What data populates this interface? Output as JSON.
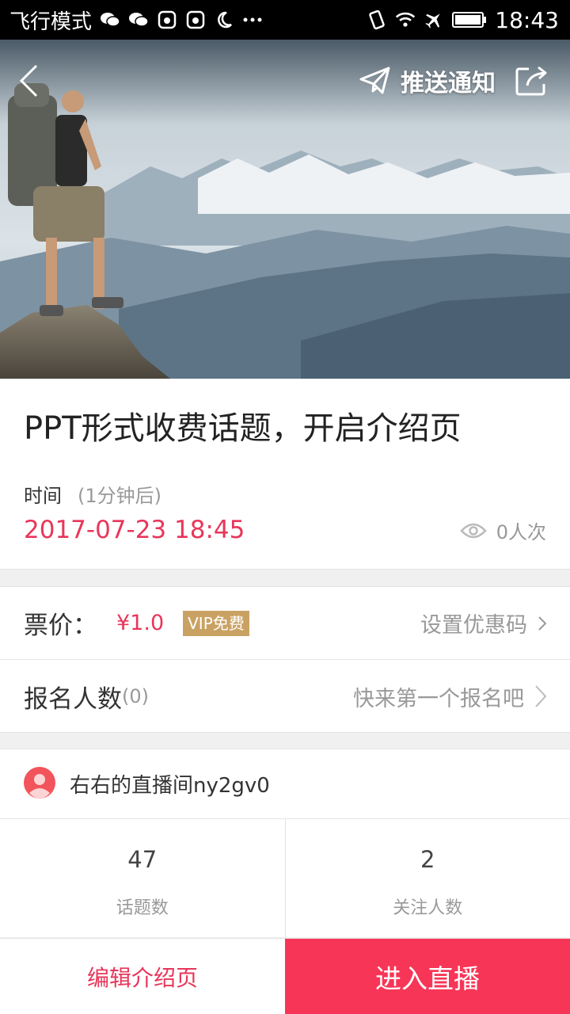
{
  "status_bar": {
    "mode_text": "飞行模式",
    "time": "18:43",
    "icons": [
      "wechat-icon",
      "wechat-icon",
      "huawei-icon",
      "huawei-icon",
      "moon-icon",
      "more-dots-icon",
      "vibrate-icon",
      "wifi-icon",
      "airplane-icon",
      "battery-icon"
    ]
  },
  "header": {
    "push_label": "推送通知",
    "back_icon": "chevron-left-icon",
    "share_icon": "share-icon"
  },
  "topic": {
    "title": "PPT形式收费话题，开启介绍页",
    "time_label": "时间",
    "time_relative": "(1分钟后)",
    "datetime": "2017-07-23 18:45",
    "views": "0人次"
  },
  "ticket": {
    "label": "票价：",
    "price": "¥1.0",
    "vip_badge": "VIP免费",
    "coupon_label": "设置优惠码"
  },
  "signup": {
    "label": "报名人数",
    "count": "(0)",
    "prompt": "快来第一个报名吧"
  },
  "host": {
    "name": "右右的直播间ny2gv0"
  },
  "stats": [
    {
      "value": "47",
      "label": "话题数"
    },
    {
      "value": "2",
      "label": "关注人数"
    }
  ],
  "actions": {
    "edit_label": "编辑介绍页",
    "enter_label": "进入直播"
  },
  "colors": {
    "accent": "#e8365a",
    "primary_button": "#f73657",
    "vip_badge": "#c9a263"
  }
}
